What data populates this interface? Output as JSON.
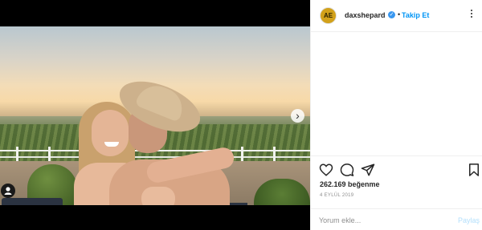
{
  "post": {
    "username": "daxshepard",
    "avatar_text": "AE",
    "follow_label": "Takip Et",
    "separator": "•",
    "likes": "262.169 beğenme",
    "date": "4 EYLÜL 2019"
  },
  "comment": {
    "placeholder": "Yorum ekle...",
    "post_label": "Paylaş"
  },
  "media": {
    "next_glyph": "›"
  },
  "colors": {
    "accent": "#0095f6",
    "verified": "#3897f0",
    "avatar": "#d2a11a",
    "post_disabled": "#b2dffc"
  },
  "icons": [
    "heart-icon",
    "comment-icon",
    "share-icon",
    "bookmark-icon",
    "more-options-icon",
    "verified-badge-icon",
    "user-tag-icon",
    "next-arrow-icon"
  ]
}
